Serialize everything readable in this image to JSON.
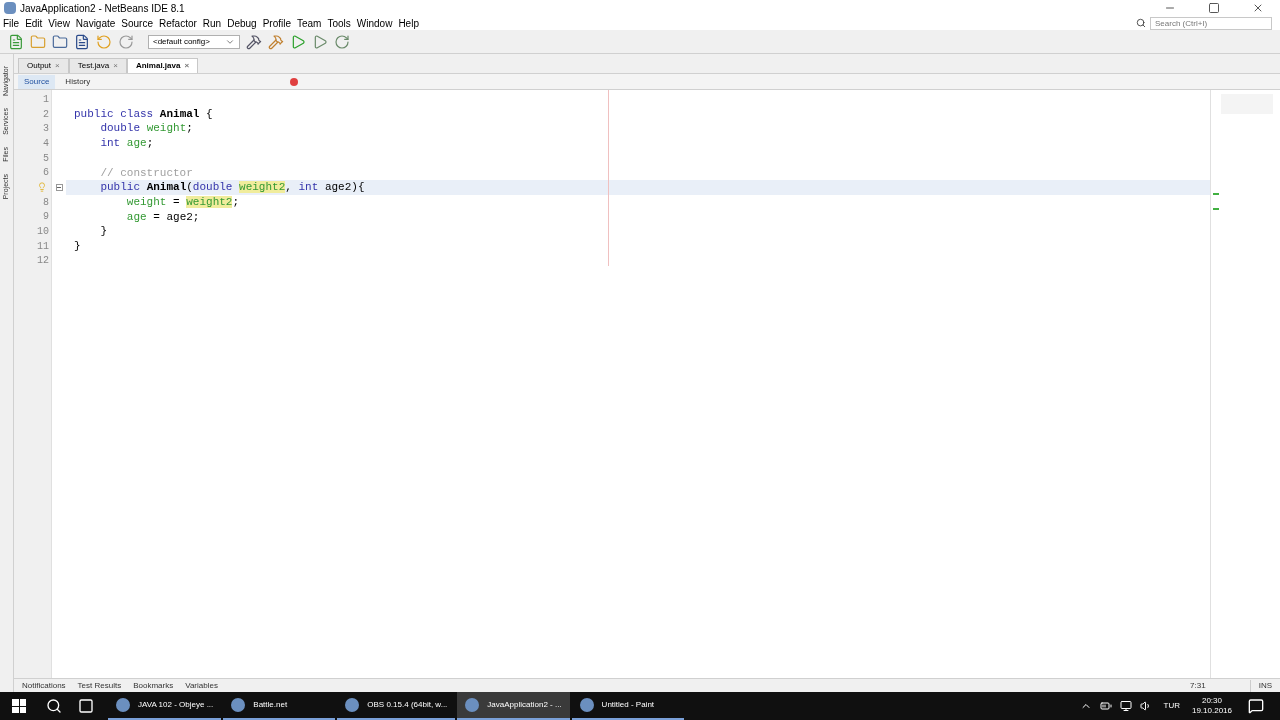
{
  "window": {
    "title": "JavaApplication2 - NetBeans IDE 8.1"
  },
  "menu": [
    "File",
    "Edit",
    "View",
    "Navigate",
    "Source",
    "Refactor",
    "Run",
    "Debug",
    "Profile",
    "Team",
    "Tools",
    "Window",
    "Help"
  ],
  "search": {
    "placeholder": "Search (Ctrl+I)"
  },
  "config": {
    "value": "<default config>"
  },
  "side_tabs": [
    "Navigator",
    "Services",
    "Files",
    "Projects"
  ],
  "tabs": [
    {
      "label": "Output",
      "close": "×",
      "selected": false
    },
    {
      "label": "Test.java",
      "close": "×",
      "selected": false
    },
    {
      "label": "Animal.java",
      "close": "×",
      "selected": true
    }
  ],
  "editor_tabs": [
    {
      "label": "Source",
      "selected": true
    },
    {
      "label": "History",
      "selected": false
    }
  ],
  "code": [
    {
      "number": "1",
      "current": false
    },
    {
      "number": "2",
      "current": false,
      "tokens": [
        {
          "text": "public class ",
          "kind": "keyword"
        },
        {
          "text": "Animal",
          "kind": "classname"
        },
        {
          "text": " {",
          "kind": "plain"
        }
      ]
    },
    {
      "number": "3",
      "current": false,
      "tokens": [
        {
          "text": "    double ",
          "kind": "keyword"
        },
        {
          "text": "weight",
          "kind": "field"
        },
        {
          "text": ";",
          "kind": "plain"
        }
      ]
    },
    {
      "number": "4",
      "current": false,
      "tokens": [
        {
          "text": "    int ",
          "kind": "keyword"
        },
        {
          "text": "age",
          "kind": "field"
        },
        {
          "text": ";",
          "kind": "plain"
        }
      ]
    },
    {
      "number": "5",
      "current": false
    },
    {
      "number": "6",
      "current": false,
      "tokens": [
        {
          "text": "    // constructor",
          "kind": "comment"
        }
      ]
    },
    {
      "current": true,
      "bulb": true,
      "fold": true,
      "tokens": [
        {
          "text": "    public ",
          "kind": "keyword"
        },
        {
          "text": "Animal",
          "kind": "classname"
        },
        {
          "text": "(",
          "kind": "plain"
        },
        {
          "text": "double ",
          "kind": "keyword"
        },
        {
          "text": "weight2",
          "kind": "highlight"
        },
        {
          "text": ", ",
          "kind": "plain"
        },
        {
          "text": "int ",
          "kind": "keyword"
        },
        {
          "text": "age2){",
          "kind": "plain"
        }
      ]
    },
    {
      "number": "8",
      "current": false,
      "tokens": [
        {
          "text": "        weight",
          "kind": "field"
        },
        {
          "text": " = ",
          "kind": "plain"
        },
        {
          "text": "weight2",
          "kind": "highlight"
        },
        {
          "text": ";",
          "kind": "plain"
        }
      ]
    },
    {
      "number": "9",
      "current": false,
      "tokens": [
        {
          "text": "        age",
          "kind": "field"
        },
        {
          "text": " = age2;",
          "kind": "plain"
        }
      ]
    },
    {
      "number": "10",
      "current": false,
      "tokens": [
        {
          "text": "    }",
          "kind": "plain"
        }
      ]
    },
    {
      "number": "11",
      "current": false,
      "tokens": [
        {
          "text": "}",
          "kind": "plain"
        }
      ]
    },
    {
      "number": "12",
      "current": false
    }
  ],
  "bottom_tabs": [
    "Notifications",
    "Test Results",
    "Bookmarks",
    "Variables"
  ],
  "status_bar": {
    "position": "7:31",
    "mode": "INS"
  },
  "taskbar": {
    "items": [
      {
        "label": "JAVA 102 - Objeye ...",
        "selected": false
      },
      {
        "label": "Battle.net",
        "selected": false
      },
      {
        "label": "OBS 0.15.4 (64bit, w...",
        "selected": false
      },
      {
        "label": "JavaApplication2 - ...",
        "selected": true
      },
      {
        "label": "Untitled - Paint",
        "selected": false
      }
    ],
    "language": "TUR",
    "time": "20:30",
    "date": "19.10.2016"
  }
}
